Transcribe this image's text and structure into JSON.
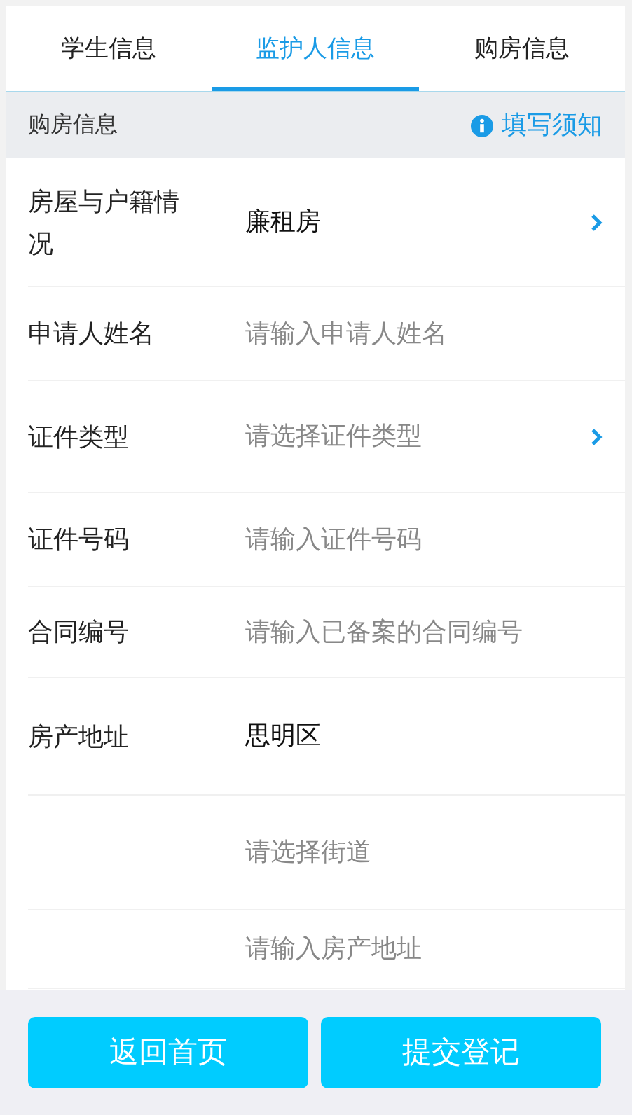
{
  "tabs": [
    {
      "label": "学生信息",
      "selected": false
    },
    {
      "label": "监护人信息",
      "selected": true
    },
    {
      "label": "购房信息",
      "selected": false
    }
  ],
  "section": {
    "title": "购房信息",
    "notice": "填写须知"
  },
  "fields": [
    {
      "label": "房屋与户籍情况",
      "kind": "select",
      "value": "廉租房"
    },
    {
      "label": "申请人姓名",
      "kind": "input",
      "placeholder": "请输入申请人姓名"
    },
    {
      "label": "证件类型",
      "kind": "select",
      "placeholder": "请选择证件类型"
    },
    {
      "label": "证件号码",
      "kind": "input",
      "placeholder": "请输入证件号码"
    },
    {
      "label": "合同编号",
      "kind": "input",
      "placeholder": "请输入已备案的合同编号"
    },
    {
      "label": "房产地址",
      "kind": "picker",
      "value": "思明区"
    },
    {
      "kind": "picker",
      "placeholder": "请选择街道"
    },
    {
      "kind": "input",
      "placeholder": "请输入房产地址"
    }
  ],
  "buttons": [
    "返回首页",
    "提交登记"
  ]
}
